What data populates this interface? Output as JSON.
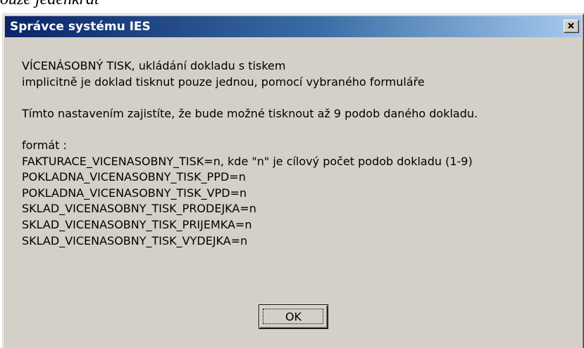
{
  "document": {
    "fragment_text": "ouze jedenkrát"
  },
  "dialog": {
    "title": "Správce systému IES",
    "close_label": "×",
    "message_lines": [
      "VÍCENÁSOBNÝ TISK, ukládání dokladu s tiskem",
      "implicitně je doklad tisknut pouze jednou, pomocí vybraného formuláře",
      "",
      "Tímto nastavením zajistíte, že bude možné tisknout až 9 podob daného dokladu.",
      "",
      "formát :",
      "FAKTURACE_VICENASOBNY_TISK=n, kde \"n\" je cílový počet podob dokladu (1-9)",
      "POKLADNA_VICENASOBNY_TISK_PPD=n",
      "POKLADNA_VICENASOBNY_TISK_VPD=n",
      "SKLAD_VICENASOBNY_TISK_PRODEJKA=n",
      "SKLAD_VICENASOBNY_TISK_PRIJEMKA=n",
      "SKLAD_VICENASOBNY_TISK_VYDEJKA=n"
    ],
    "ok_label": "OK"
  },
  "colors": {
    "titlebar_start": "#0a246a",
    "titlebar_end": "#a6caf0",
    "dialog_face": "#d4d0c8",
    "title_text": "#ffffff"
  },
  "icons": {
    "close": "close-icon"
  }
}
